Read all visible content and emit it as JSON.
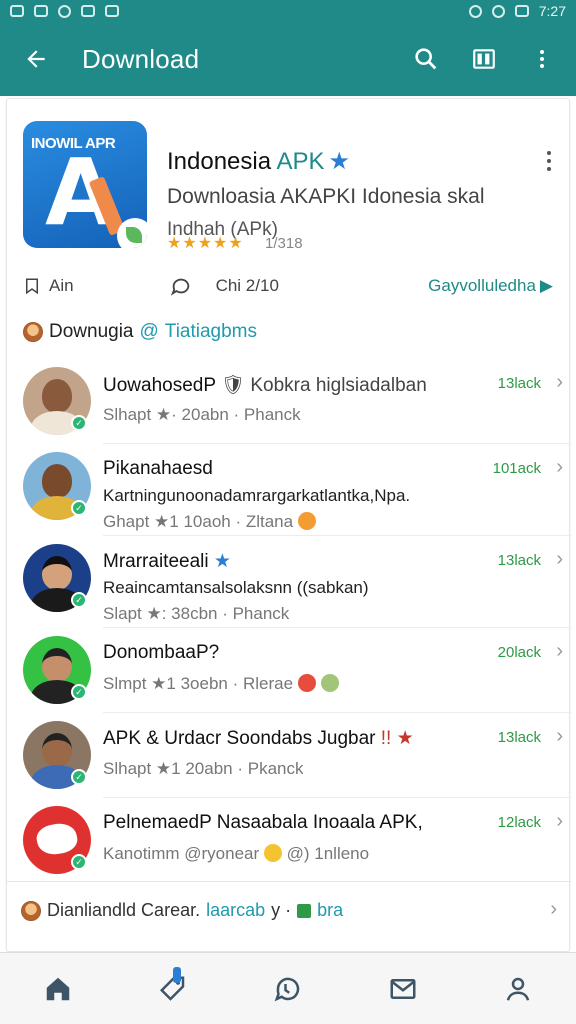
{
  "status_bar": {
    "time": "7:27"
  },
  "app_bar": {
    "title": "Download",
    "back_icon": "arrow-back-icon",
    "actions": [
      "search-icon",
      "library-icon",
      "more-vert-icon"
    ]
  },
  "app": {
    "icon_text": "INOWIL APR",
    "icon_letter": "A",
    "title_main": "Indonesia ",
    "title_accent": "APK",
    "title_star": "★",
    "subtitle_line1": "Downloasia AKAPKI Idonesia skal",
    "subtitle_line2": "Indhah (APk)",
    "stars": "★★★★★",
    "rating_count": "1/318",
    "meta_left": "Ain",
    "meta_mid": "Chi 2/10",
    "cta": "Gayvolluledha"
  },
  "section": {
    "title": "Downugia",
    "at": "@ ",
    "handle": "Tiatiagbms"
  },
  "list": [
    {
      "name": "UowahosedP",
      "name_extra": " 🛡 Kobkra higlsiadalban",
      "line2": "Slhapt ★· 20abn · Phanck",
      "tag": "13lack"
    },
    {
      "name": "Pikanahaesd",
      "line2": "Kartningunoonadamrargarkatlantka,Npa.",
      "line3": "Ghapt ★1 10aoh · Zltana",
      "tag": "101ack"
    },
    {
      "name": "Mrarraiteeali",
      "name_extra": " ★",
      "line2": "Reaincamtansalsolaksnn ((sabkan)",
      "line3": "Slapt ★: 38cbn · Phanck",
      "tag": "13lack"
    },
    {
      "name": "DonombaaP?",
      "line2": "Slmpt ★1 3oebn · Rlerae",
      "tag": "20lack"
    },
    {
      "name": "APK & Urdacr Soondabs Jugbar",
      "name_extra": " !! ★",
      "line2": "Slhapt ★1 20abn · Pkanck",
      "tag": "13lack"
    },
    {
      "name": "PelnemaedP",
      "name_extra": " Nasaabala Inoaala APK,",
      "line2": "Kanotimm @ryonear",
      "line2_extra": " @)  1nlleno",
      "tag": "12lack"
    }
  ],
  "bottom_section": {
    "text": "Dianliandld Carear.",
    "teal": "laarcab",
    "sep": " y · ",
    "green": "bra"
  },
  "bottom_nav": [
    "home-icon",
    "tag-icon",
    "chat-icon",
    "mail-icon",
    "profile-icon"
  ],
  "colors": {
    "appbar": "#1f8a88",
    "accent_teal": "#1f9ab0",
    "tag_green": "#2e9a45",
    "star_gold": "#f0a11c"
  }
}
